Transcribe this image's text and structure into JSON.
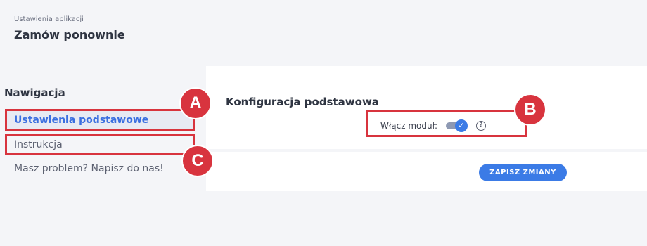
{
  "header": {
    "breadcrumb": "Ustawienia aplikacji",
    "title": "Zamów ponownie"
  },
  "sidebar": {
    "heading": "Nawigacja",
    "items": [
      {
        "label": "Ustawienia podstawowe",
        "active": true
      },
      {
        "label": "Instrukcja",
        "active": false
      },
      {
        "label": "Masz problem? Napisz do nas!",
        "active": false
      }
    ]
  },
  "main": {
    "section_title": "Konfiguracja podstawowa",
    "module_toggle": {
      "label": "Włącz moduł:",
      "enabled": true
    },
    "help_icon": "question-circle",
    "save_label": "ZAPISZ ZMIANY"
  },
  "annotations": {
    "markers": [
      "A",
      "B",
      "C"
    ]
  },
  "colors": {
    "accent": "#3b7be6",
    "annotation": "#d8343e",
    "active_text": "#3b6fe0"
  }
}
